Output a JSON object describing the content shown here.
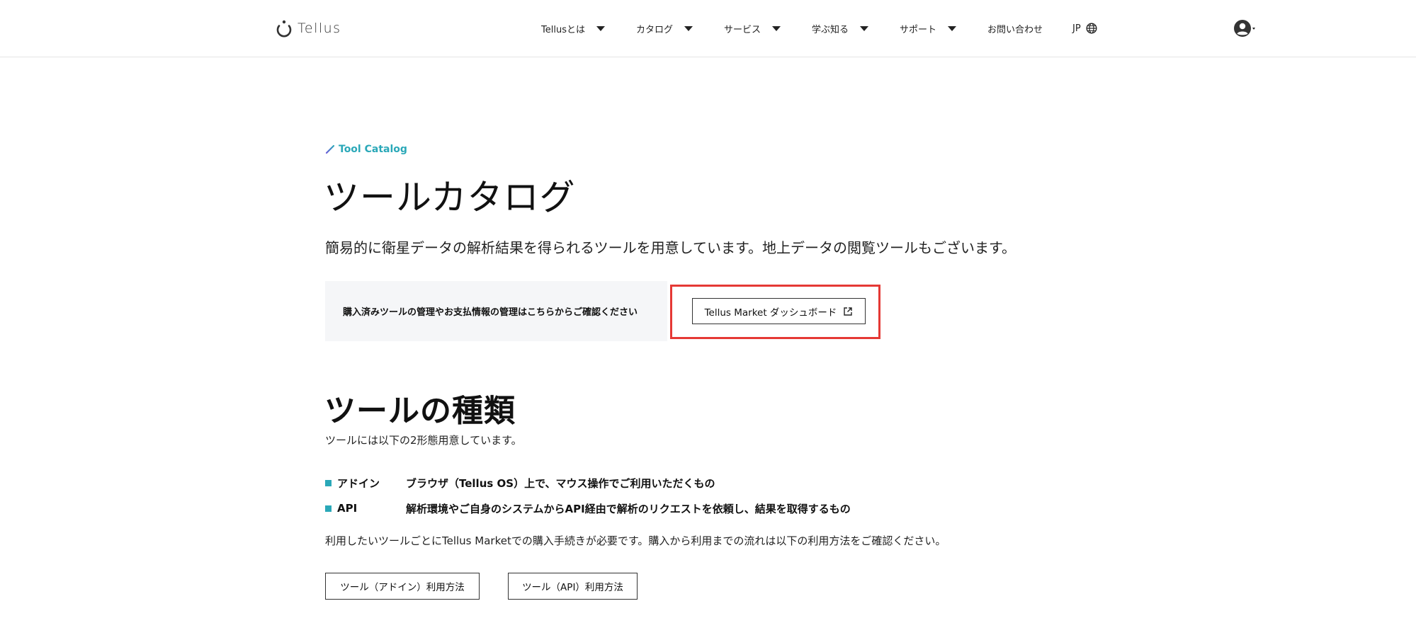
{
  "header": {
    "logo_text": "Tellus",
    "nav": [
      {
        "label": "Tellusとは"
      },
      {
        "label": "カタログ"
      },
      {
        "label": "サービス"
      },
      {
        "label": "学ぶ知る"
      },
      {
        "label": "サポート"
      },
      {
        "label": "お問い合わせ"
      },
      {
        "label": "JP"
      }
    ]
  },
  "main": {
    "eyebrow": "Tool Catalog",
    "title": "ツールカタログ",
    "lead": "簡易的に衛星データの解析結果を得られるツールを用意しています。地上データの閲覧ツールもございます。",
    "notice_text": "購入済みツールの管理やお支払情報の管理はこちらからご確認ください",
    "dashboard_button": "Tellus Market ダッシュボード",
    "section_title": "ツールの種類",
    "section_desc": "ツールには以下の2形態用意しています。",
    "types": [
      {
        "name": "アドイン",
        "desc": "ブラウザ（Tellus OS）上で、マウス操作でご利用いただくもの"
      },
      {
        "name": "API",
        "desc": "解析環境やご自身のシステムからAPI経由で解析のリクエストを依頼し、結果を取得するもの"
      }
    ],
    "note": "利用したいツールごとにTellus Marketでの購入手続きが必要です。購入から利用までの流れは以下の利用方法をご確認ください。",
    "howto_buttons": [
      {
        "label": "ツール（アドイン）利用方法"
      },
      {
        "label": "ツール（API）利用方法"
      }
    ]
  },
  "colors": {
    "accent": "#2aa8b8",
    "highlight": "#e53935",
    "notice_bg": "#f5f6f8"
  }
}
